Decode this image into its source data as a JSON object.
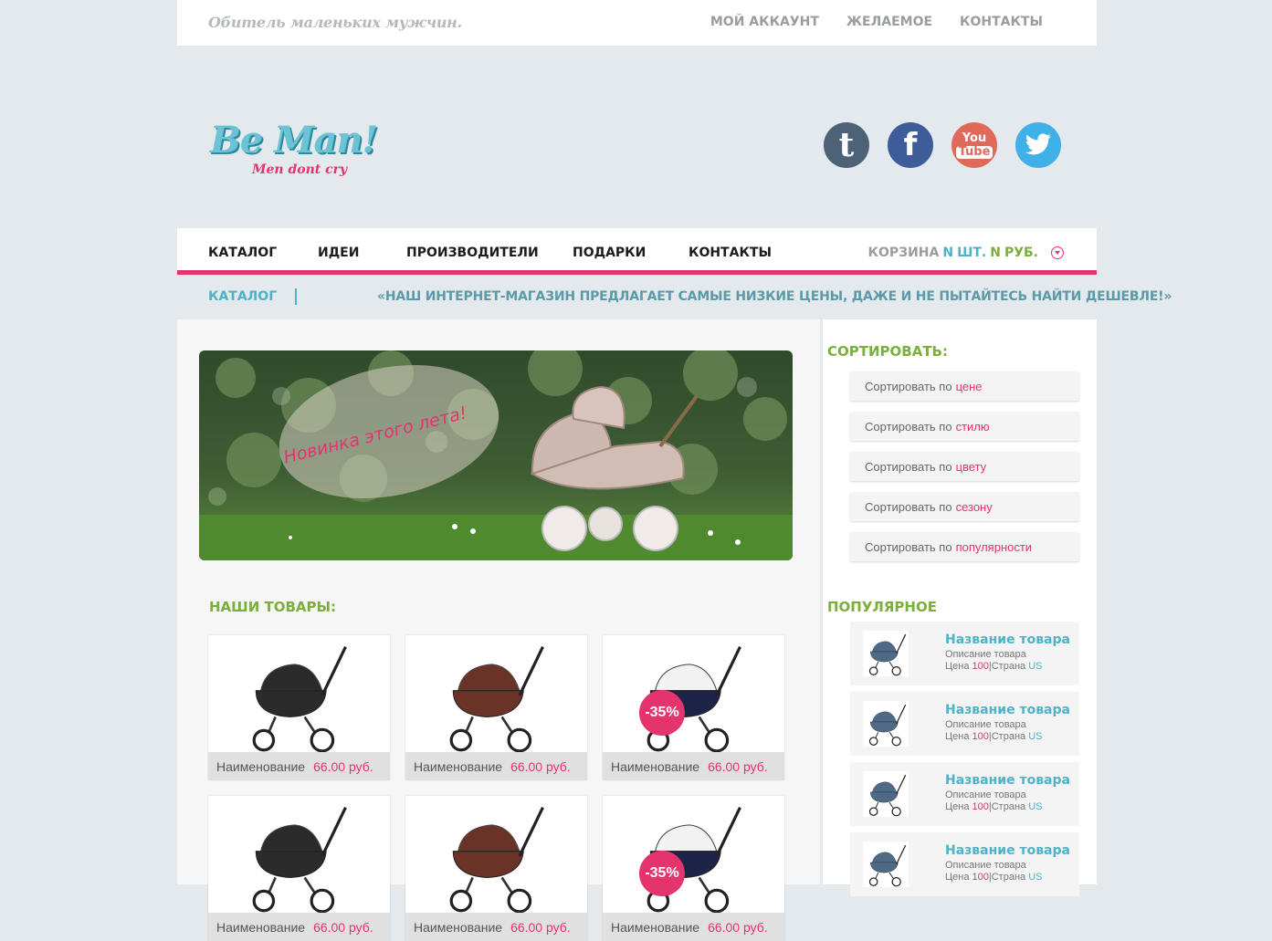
{
  "topbar": {
    "tagline": "Обитель маленьких мужчин.",
    "links": [
      "МОЙ АККАУНТ",
      "ЖЕЛАЕМОЕ",
      "КОНТАКТЫ"
    ]
  },
  "header": {
    "logo_main": "Be Man!",
    "logo_sub": "Men dont cry",
    "social": [
      "tumblr-icon",
      "facebook-icon",
      "youtube-icon",
      "twitter-icon"
    ],
    "youtube_top": "You",
    "youtube_bottom": "Tube"
  },
  "nav": {
    "items": [
      "КАТАЛОГ",
      "ИДЕИ",
      "ПРОИЗВОДИТЕЛИ",
      "ПОДАРКИ",
      "КОНТАКТЫ"
    ],
    "cart_label": "КОРЗИНА",
    "cart_n1": "N",
    "cart_units": "ШТ.",
    "cart_n2": "N",
    "cart_currency": "РУБ."
  },
  "breadcrumb": {
    "current": "КАТАЛОГ",
    "message": "«НАШ ИНТЕРНЕТ-МАГАЗИН ПРЕДЛАГАЕТ САМЫЕ НИЗКИЕ ЦЕНЫ, ДАЖЕ И НЕ ПЫТАЙТЕСЬ НАЙТИ ДЕШЕВЛЕ!»"
  },
  "banner": {
    "text": "Новинка этого лета!"
  },
  "products": {
    "title": "НАШИ ТОВАРЫ:",
    "items": [
      {
        "name": "Наименование",
        "price": "66.00 руб.",
        "badge": "",
        "kind": "black"
      },
      {
        "name": "Наименование",
        "price": "66.00 руб.",
        "badge": "",
        "kind": "brown"
      },
      {
        "name": "Наименование",
        "price": "66.00 руб.",
        "badge": "-35%",
        "kind": "navy"
      },
      {
        "name": "Наименование",
        "price": "66.00 руб.",
        "badge": "",
        "kind": "black"
      },
      {
        "name": "Наименование",
        "price": "66.00 руб.",
        "badge": "",
        "kind": "brown"
      },
      {
        "name": "Наименование",
        "price": "66.00 руб.",
        "badge": "-35%",
        "kind": "navy"
      }
    ]
  },
  "sort": {
    "title": "СОРТИРОВАТЬ:",
    "prefix": "Сортировать по",
    "options": [
      "цене",
      "стилю",
      "цвету",
      "сезону",
      "популярности"
    ]
  },
  "popular": {
    "title": "ПОПУЛЯРНОЕ",
    "items": [
      {
        "title": "Название товара",
        "desc": "Описание товара",
        "price_label": "Цена",
        "price": "100",
        "country_label": "Страна",
        "country": "US"
      },
      {
        "title": "Название товара",
        "desc": "Описание товара",
        "price_label": "Цена",
        "price": "100",
        "country_label": "Страна",
        "country": "US"
      },
      {
        "title": "Название товара",
        "desc": "Описание товара",
        "price_label": "Цена",
        "price": "100",
        "country_label": "Страна",
        "country": "US"
      },
      {
        "title": "Название товара",
        "desc": "Описание товара",
        "price_label": "Цена",
        "price": "100",
        "country_label": "Страна",
        "country": "US"
      }
    ]
  },
  "colors": {
    "accent_pink": "#e5336e",
    "accent_blue": "#4db3c9",
    "accent_green": "#7aaf3c",
    "page_bg": "#e3e9ec"
  }
}
